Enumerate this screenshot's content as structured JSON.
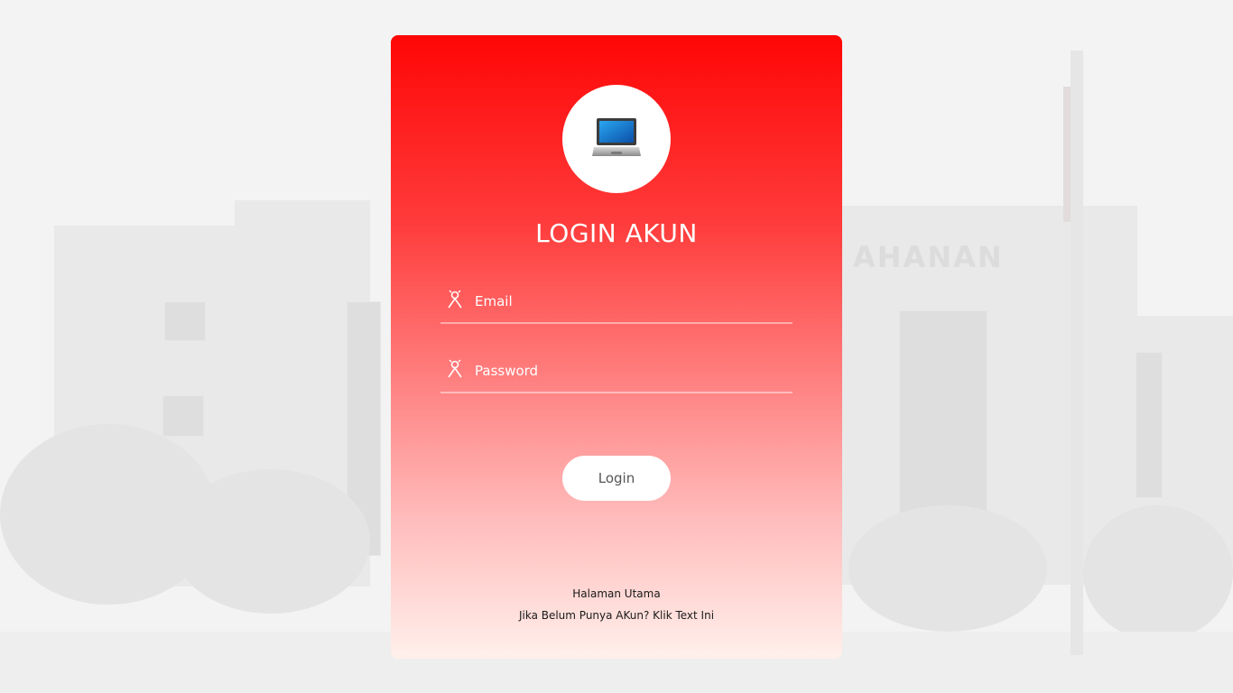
{
  "login": {
    "title": "LOGIN AKUN",
    "email_placeholder": "Email",
    "password_placeholder": "Password",
    "button_label": "Login",
    "home_link": "Halaman Utama",
    "register_link": "Jika Belum Punya AKun? Klik Text Ini"
  },
  "background": {
    "watermark_text": "AHANAN"
  },
  "icons": {
    "avatar": "laptop-icon",
    "email": "user-icon",
    "password": "user-icon"
  },
  "colors": {
    "gradient_top": "#ff0606",
    "gradient_bottom": "#fff0eb",
    "button_bg": "#ffffff",
    "text_light": "#ffffff"
  }
}
